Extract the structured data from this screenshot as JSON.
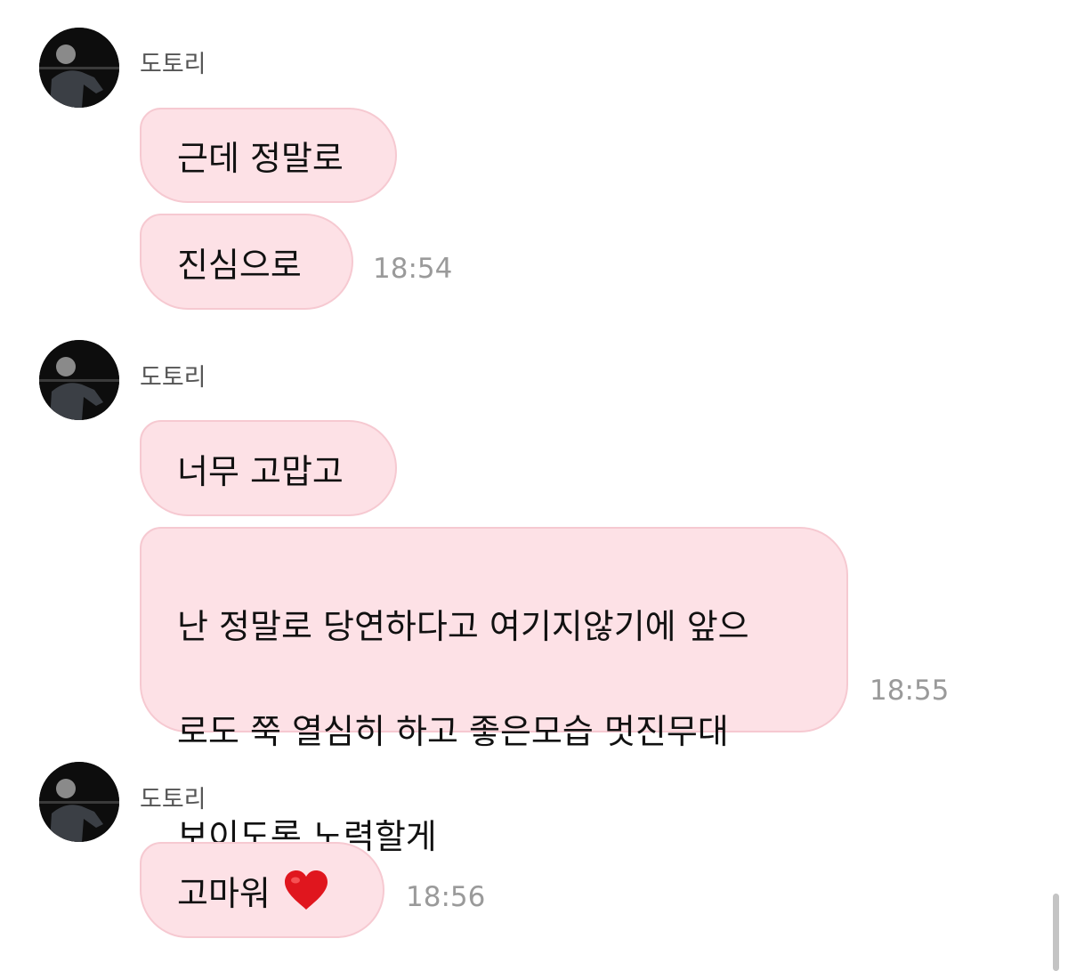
{
  "colors": {
    "bubble_bg": "#fde1e6",
    "bubble_border": "#f6c9d1",
    "timestamp": "#9a9a9a",
    "sender": "#555555",
    "heart": "#e0161e"
  },
  "groups": [
    {
      "sender": "도토리",
      "messages": [
        {
          "text": "근데 정말로"
        },
        {
          "text": "진심으로",
          "time": "18:54"
        }
      ]
    },
    {
      "sender": "도토리",
      "messages": [
        {
          "text": "너무 고맙고"
        },
        {
          "lines": [
            "난 정말로 당연하다고 여기지않기에  앞으",
            "로도 쭉 열심히 하고 좋은모습 멋진무대",
            "보이도록 노력할게"
          ],
          "time": "18:55"
        }
      ]
    },
    {
      "sender": "도토리",
      "messages": [
        {
          "text": "고마워",
          "emoji": "red-heart-icon",
          "time": "18:56"
        }
      ]
    }
  ]
}
